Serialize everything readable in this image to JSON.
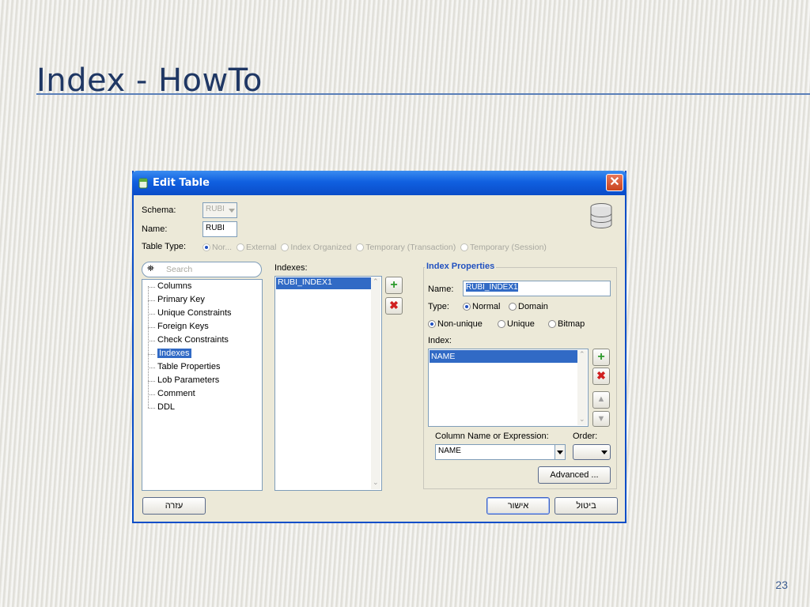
{
  "slide": {
    "title": "Index - HowTo",
    "page_number": "23"
  },
  "window": {
    "title": "Edit Table",
    "close_glyph": "✕"
  },
  "form": {
    "schema_label": "Schema:",
    "schema_value": "RUBI",
    "name_label": "Name:",
    "name_value": "RUBI",
    "table_type_label": "Table Type:",
    "table_types": [
      "Nor...",
      "External",
      "Index Organized",
      "Temporary (Transaction)",
      "Temporary (Session)"
    ],
    "table_type_selected": "Nor..."
  },
  "nav": {
    "search_placeholder": "Search",
    "items": [
      "Columns",
      "Primary Key",
      "Unique Constraints",
      "Foreign Keys",
      "Check Constraints",
      "Indexes",
      "Table Properties",
      "Lob Parameters",
      "Comment",
      "DDL"
    ],
    "selected": "Indexes"
  },
  "indexes": {
    "label": "Indexes:",
    "items": [
      "RUBI_INDEX1"
    ],
    "selected": "RUBI_INDEX1"
  },
  "index_properties": {
    "group_title": "Index Properties",
    "name_label": "Name:",
    "name_value": "RUBI_INDEX1",
    "type_label": "Type:",
    "type_normal": "Normal",
    "type_domain": "Domain",
    "type_selected": "Normal",
    "uniqueness": [
      "Non-unique",
      "Unique",
      "Bitmap"
    ],
    "uniqueness_selected": "Non-unique",
    "index_label": "Index:",
    "index_items": [
      "NAME"
    ],
    "column_expr_label": "Column Name or Expression:",
    "order_label": "Order:",
    "column_value": "NAME",
    "order_value": "",
    "advanced_label": "Advanced ..."
  },
  "footer": {
    "help_label": "עזרה",
    "ok_label": "אישור",
    "cancel_label": "ביטול"
  },
  "icons": {
    "add": "+",
    "remove": "✖",
    "up": "▲",
    "down": "▼"
  },
  "colors": {
    "title_text": "#1f3764",
    "accent": "#316ac5",
    "titlebar": "#1060e0"
  }
}
